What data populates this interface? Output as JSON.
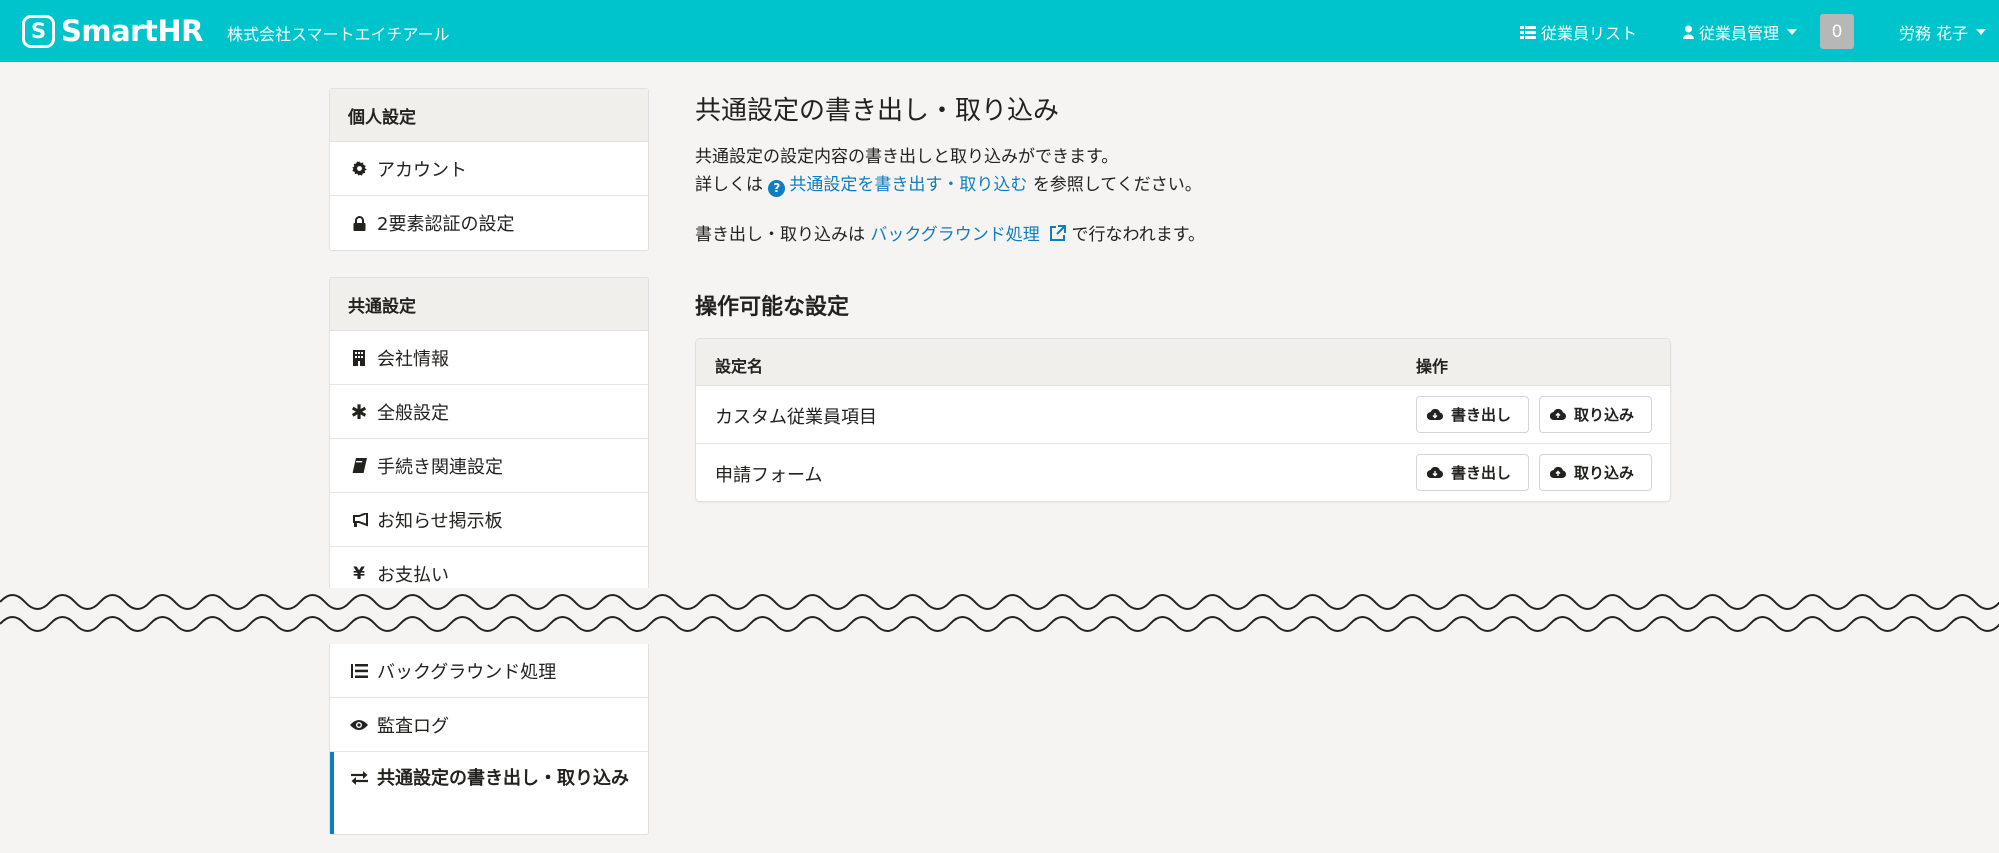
{
  "header": {
    "brand": "SmartHR",
    "company": "株式会社スマートエイチアール",
    "nav_employee_list": "従業員リスト",
    "nav_employee_management": "従業員管理",
    "notification_count": "0",
    "user_name": "労務 花子",
    "icons": [
      "list-icon",
      "user-icon",
      "caret-down-icon"
    ]
  },
  "sidebar": {
    "personal": {
      "title": "個人設定",
      "items": [
        {
          "label": "アカウント",
          "icon": "gear-icon"
        },
        {
          "label": "2要素認証の設定",
          "icon": "lock-icon"
        }
      ]
    },
    "common": {
      "title": "共通設定",
      "items": [
        {
          "label": "会社情報",
          "icon": "building-icon"
        },
        {
          "label": "全般設定",
          "icon": "asterisk-icon"
        },
        {
          "label": "手続き関連設定",
          "icon": "book-icon"
        },
        {
          "label": "お知らせ掲示板",
          "icon": "megaphone-icon"
        },
        {
          "label": "お支払い",
          "icon": "yen-icon"
        },
        {
          "label": "バックグラウンド処理",
          "icon": "list-ol-icon"
        },
        {
          "label": "監査ログ",
          "icon": "eye-icon"
        },
        {
          "label": "共通設定の書き出し・取り込み",
          "icon": "exchange-icon",
          "active": true
        }
      ]
    }
  },
  "main": {
    "title": "共通設定の書き出し・取り込み",
    "desc_line1": "共通設定の設定内容の書き出しと取り込みができます。",
    "desc_line2_prefix": "詳しくは",
    "desc_line2_link": "共通設定を書き出す・取り込む",
    "desc_line2_suffix": "を参照してください。",
    "desc_line3_prefix": "書き出し・取り込みは",
    "desc_line3_link": "バックグラウンド処理",
    "desc_line3_suffix": "で行なわれます。",
    "section_title": "操作可能な設定",
    "table": {
      "columns": [
        "設定名",
        "操作"
      ],
      "rows": [
        {
          "name": "カスタム従業員項目",
          "export_label": "書き出し",
          "import_label": "取り込み"
        },
        {
          "name": "申請フォーム",
          "export_label": "書き出し",
          "import_label": "取り込み"
        }
      ]
    }
  },
  "colors": {
    "header_bg": "#00c4cc",
    "link": "#0f7dc2",
    "page_bg": "#f5f4f3"
  }
}
